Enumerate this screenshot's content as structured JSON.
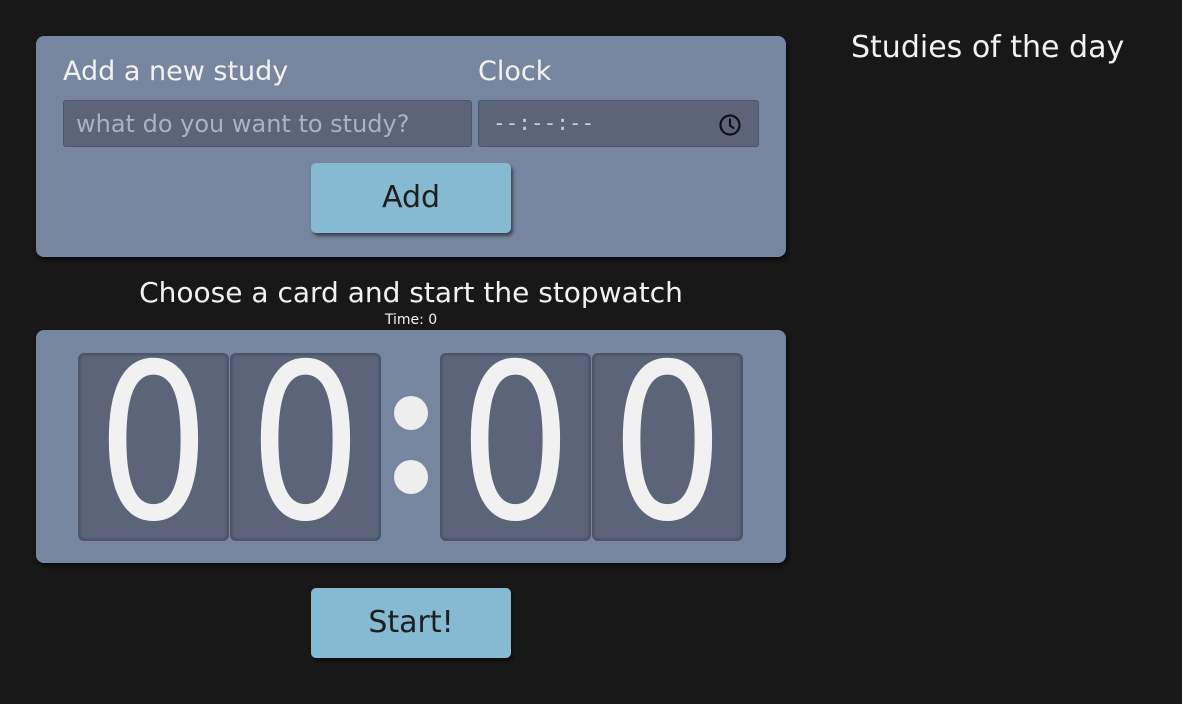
{
  "add_panel": {
    "study_label": "Add a new study",
    "study_placeholder": "what do you want to study?",
    "study_value": "",
    "clock_label": "Clock",
    "clock_value": "--:--:--",
    "clock_icon": "clock-icon",
    "add_label": "Add"
  },
  "stopwatch": {
    "title": "Choose a card and start the stopwatch",
    "time_readout": "Time: 0",
    "digits": [
      "0",
      "0",
      "0",
      "0"
    ],
    "start_label": "Start!"
  },
  "sidebar": {
    "title": "Studies of the day"
  },
  "colors": {
    "background": "#181818",
    "panel": "#7686a0",
    "card": "#5b6479",
    "button": "#86bad2",
    "text": "#f2f2f2"
  }
}
